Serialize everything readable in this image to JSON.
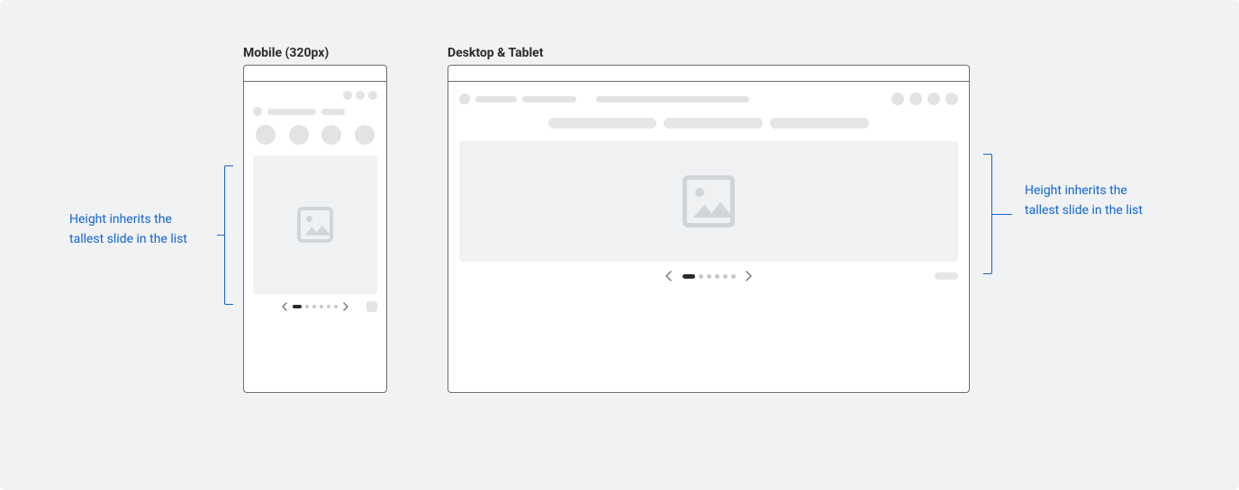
{
  "labels": {
    "mobile": "Mobile (320px)",
    "desktop": "Desktop & Tablet"
  },
  "callouts": {
    "left": "Height inherits the\ntallest slide in the list",
    "right": "Height inherits the\ntallest slide in the list"
  }
}
